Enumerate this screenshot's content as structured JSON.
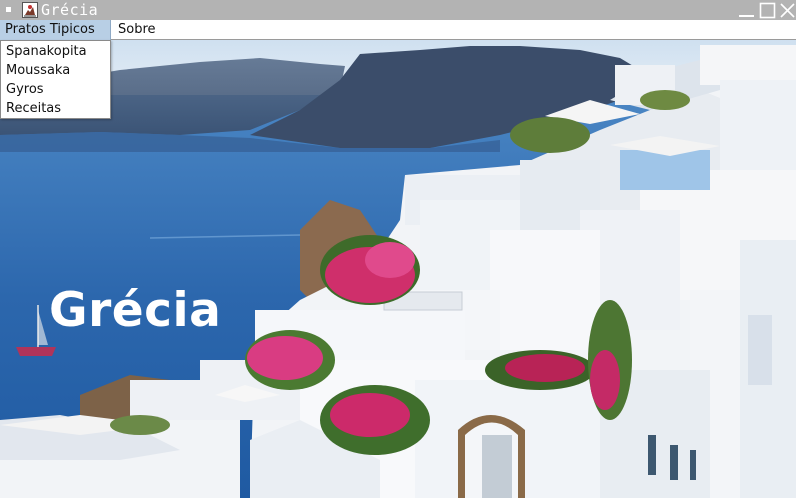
{
  "window": {
    "title": "Grécia",
    "controls": [
      "minimize",
      "maximize",
      "close"
    ]
  },
  "menubar": {
    "items": [
      {
        "label": "Pratos Tipicos",
        "open": true
      },
      {
        "label": "Sobre",
        "open": false
      }
    ]
  },
  "dropdown": {
    "items": [
      {
        "label": "Spanakopita"
      },
      {
        "label": "Moussaka"
      },
      {
        "label": "Gyros"
      },
      {
        "label": "Receitas"
      }
    ]
  },
  "content": {
    "heading": "Grécia",
    "image": "santorini-coastline-photo"
  },
  "colors": {
    "titlebar": "#b3b3b3",
    "menu_selected": "#b8cfe5",
    "sea": "#2f6fb7",
    "sky": "#d9e7f3"
  }
}
